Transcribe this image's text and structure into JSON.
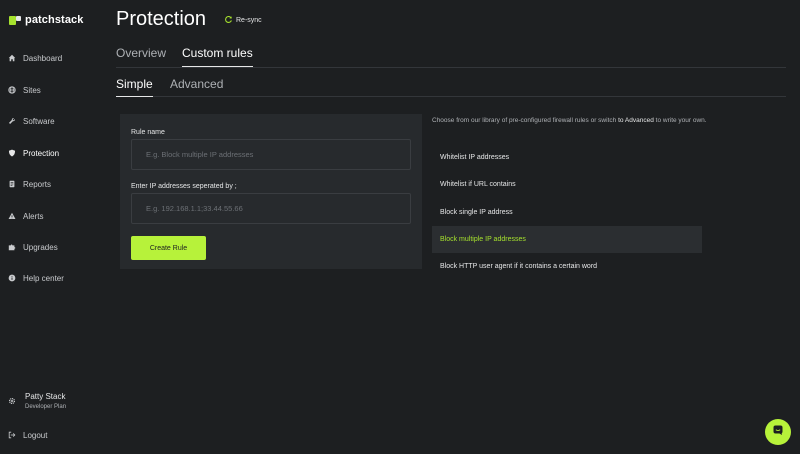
{
  "brand": {
    "name": "patchstack",
    "green": "#a6e22e",
    "accent": "#b7f23a"
  },
  "sidebar": {
    "items": [
      {
        "label": "Dashboard",
        "icon": "home-icon"
      },
      {
        "label": "Sites",
        "icon": "globe-icon"
      },
      {
        "label": "Software",
        "icon": "wrench-icon"
      },
      {
        "label": "Protection",
        "icon": "shield-icon",
        "active": true
      },
      {
        "label": "Reports",
        "icon": "report-icon"
      },
      {
        "label": "Alerts",
        "icon": "warning-icon"
      },
      {
        "label": "Upgrades",
        "icon": "puzzle-icon"
      },
      {
        "label": "Help center",
        "icon": "info-icon"
      }
    ],
    "user": {
      "name": "Patty Stack",
      "plan": "Developer Plan"
    },
    "logout": "Logout"
  },
  "header": {
    "title": "Protection",
    "resync": "Re-sync"
  },
  "tabs": [
    "Overview",
    "Custom rules"
  ],
  "subtabs": [
    "Simple",
    "Advanced"
  ],
  "form": {
    "rule_name_label": "Rule name",
    "rule_name_placeholder": "E.g. Block multiple IP addresses",
    "ip_label": "Enter IP addresses seperated by ;",
    "ip_placeholder": "E.g. 192.168.1.1;33.44.55.66",
    "submit": "Create Rule"
  },
  "library": {
    "description_pre": "Choose from our library of pre-configured firewall rules or switch",
    "description_link": "to Advanced",
    "description_mid": "to",
    "description_post": "write your own.",
    "rules": [
      "Whitelist IP addresses",
      "Whitelist if URL contains",
      "Block single IP address",
      "Block multiple IP addresses",
      "Block HTTP user agent if it contains a certain word"
    ],
    "selected_index": 3
  }
}
